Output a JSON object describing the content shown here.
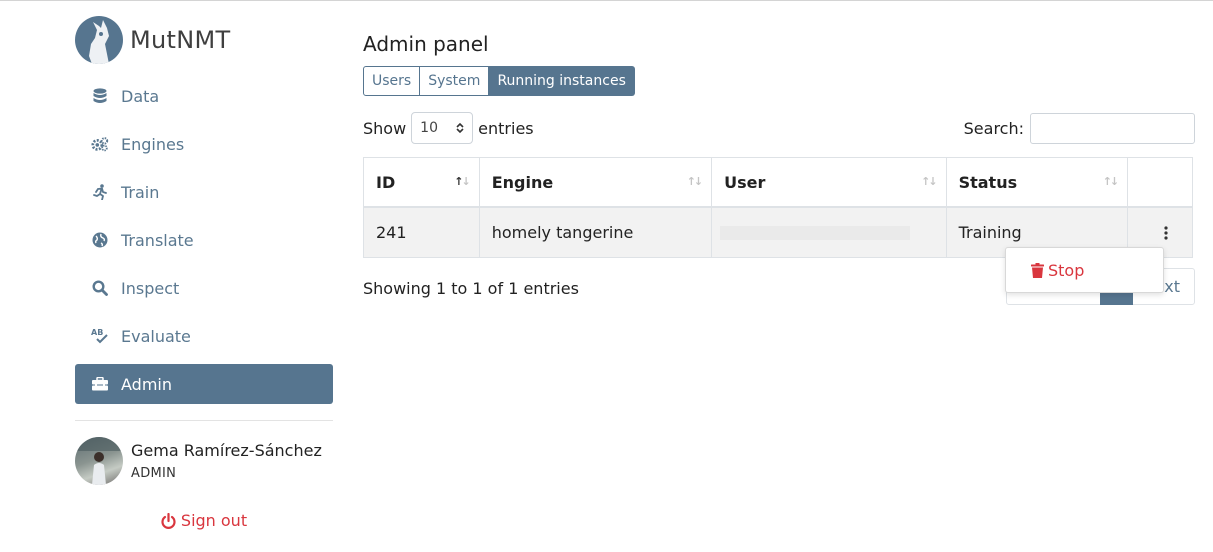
{
  "app": {
    "name": "MutNMT"
  },
  "sidebar": {
    "items": [
      {
        "label": "Data",
        "icon": "database-icon"
      },
      {
        "label": "Engines",
        "icon": "gears-icon"
      },
      {
        "label": "Train",
        "icon": "running-icon"
      },
      {
        "label": "Translate",
        "icon": "globe-icon"
      },
      {
        "label": "Inspect",
        "icon": "search-icon"
      },
      {
        "label": "Evaluate",
        "icon": "spell-check-icon"
      },
      {
        "label": "Admin",
        "icon": "toolbox-icon",
        "active": true
      }
    ],
    "user": {
      "name": "Gema Ramírez-Sánchez",
      "role": "ADMIN"
    },
    "signout_label": "Sign out"
  },
  "main": {
    "title": "Admin panel",
    "tabs": [
      {
        "label": "Users"
      },
      {
        "label": "System"
      },
      {
        "label": "Running instances",
        "active": true
      }
    ],
    "show_label": "Show",
    "entries_label": "entries",
    "page_length": "10",
    "search_label": "Search:",
    "search_value": "",
    "table": {
      "columns": [
        "ID",
        "Engine",
        "User",
        "Status",
        ""
      ],
      "rows": [
        {
          "id": "241",
          "engine": "homely tangerine",
          "user": "",
          "status": "Training"
        }
      ]
    },
    "info": "Showing 1 to 1 of 1 entries",
    "pager_next": "Next",
    "pager_next_visible": "ext",
    "dropdown": {
      "stop_label": "Stop"
    }
  },
  "colors": {
    "accent": "#56758f",
    "danger": "#d9363e",
    "row_bg": "#f2f2f2"
  }
}
